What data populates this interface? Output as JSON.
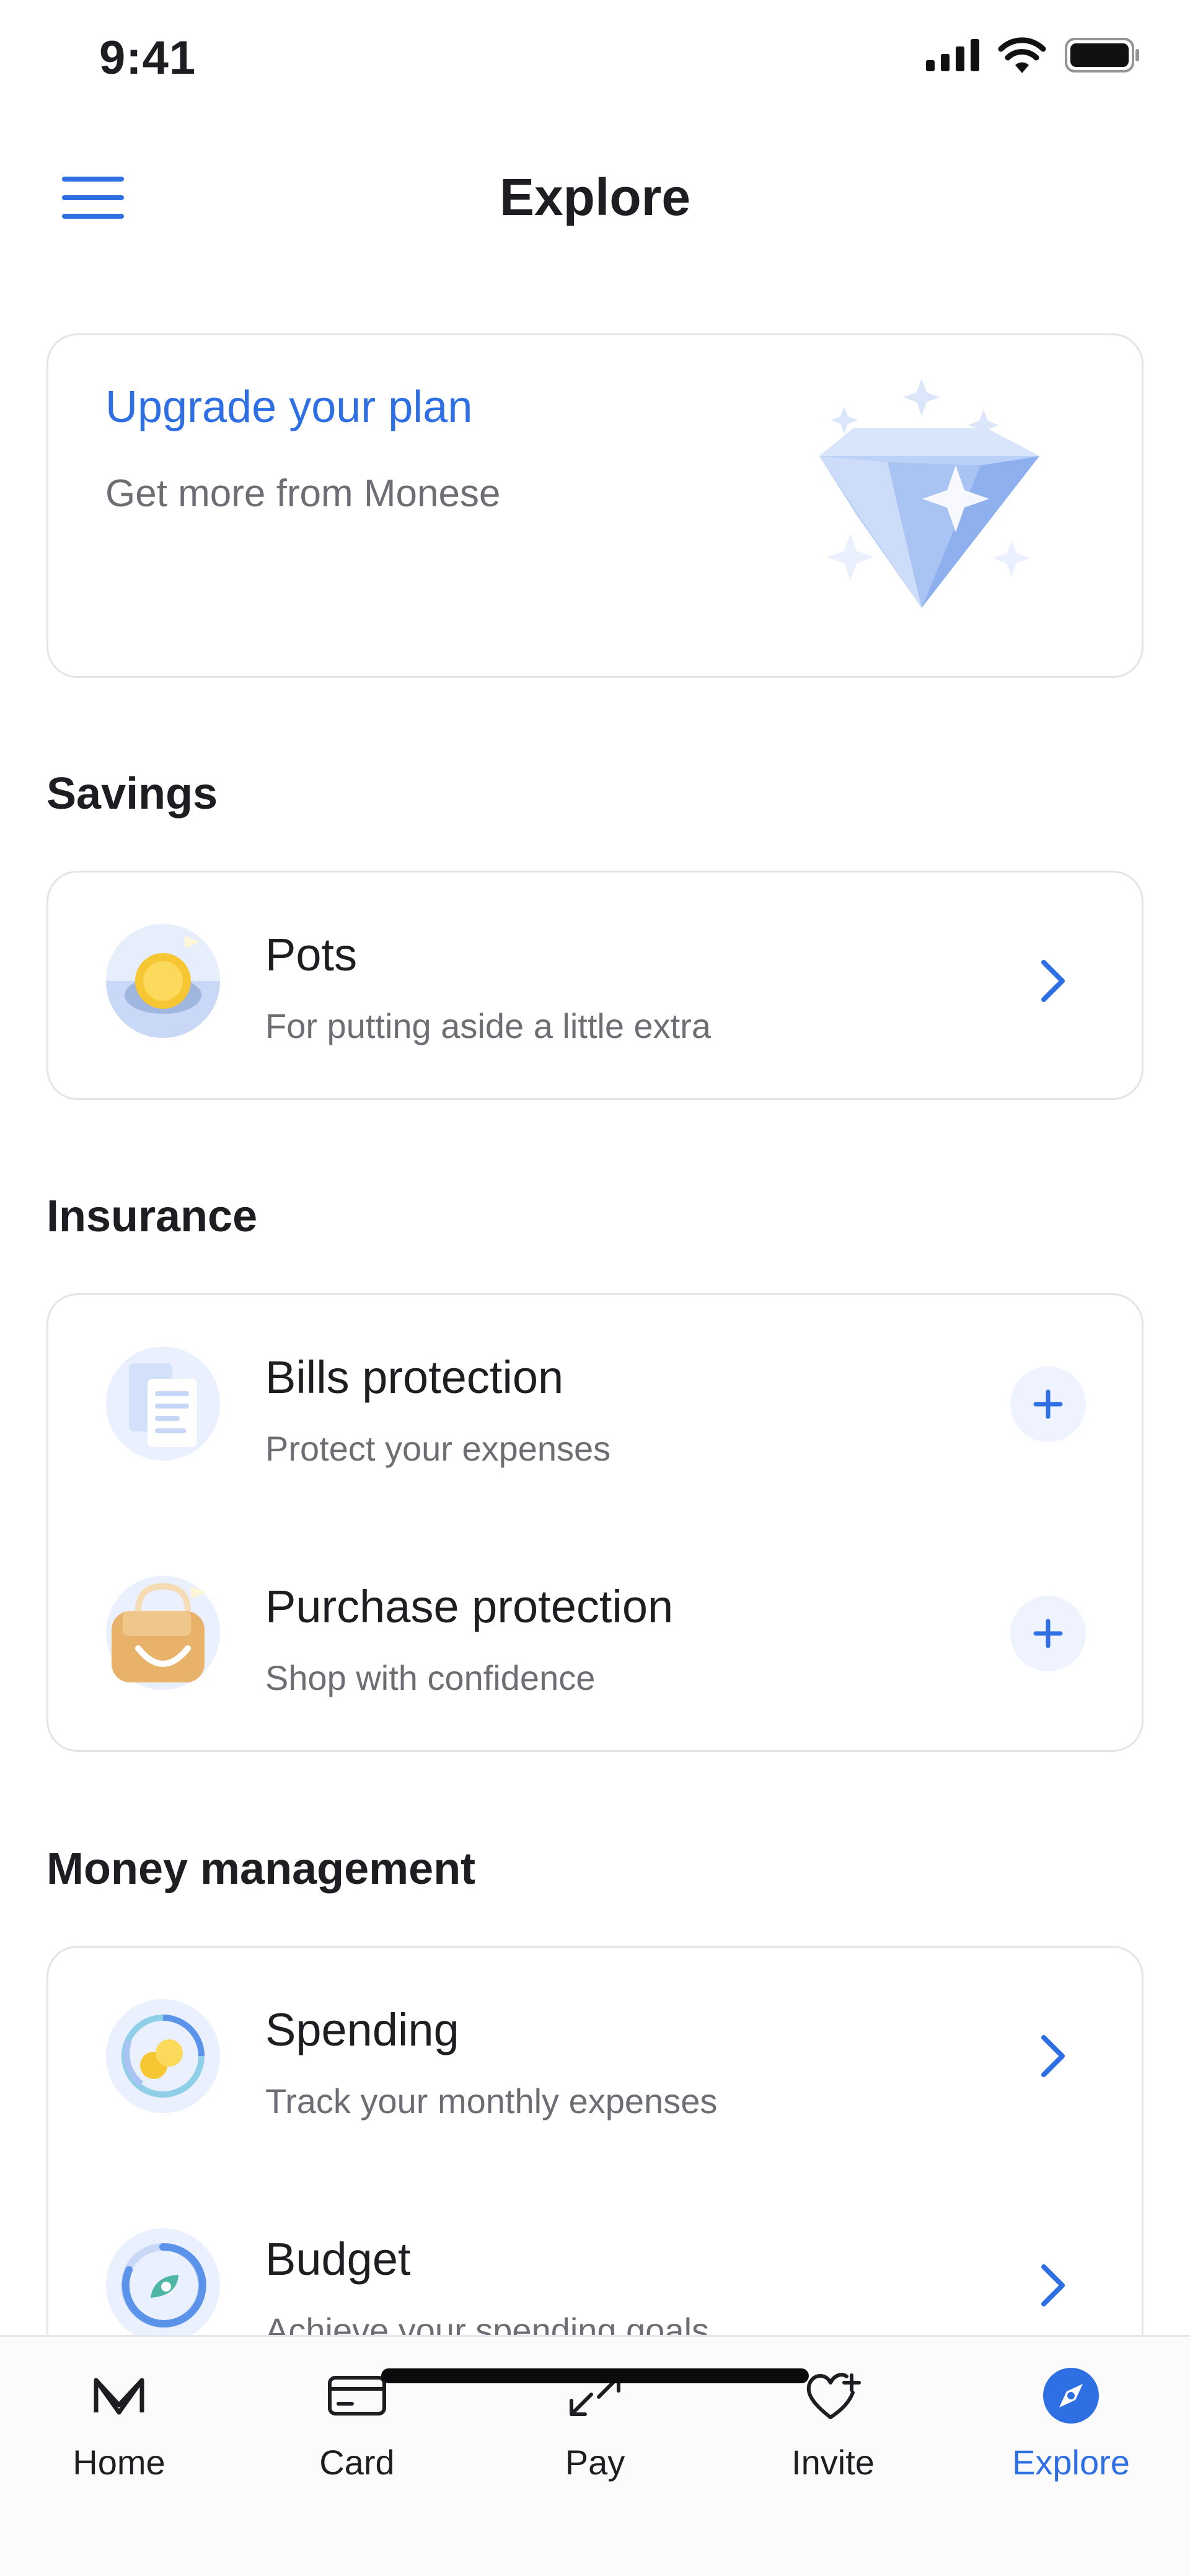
{
  "status_bar": {
    "time": "9:41"
  },
  "header": {
    "title": "Explore"
  },
  "upgrade": {
    "title": "Upgrade your plan",
    "subtitle": "Get more from Monese"
  },
  "sections": {
    "savings": {
      "title": "Savings",
      "items": [
        {
          "title": "Pots",
          "subtitle": "For putting aside a little extra",
          "action": "chevron-right-icon"
        }
      ]
    },
    "insurance": {
      "title": "Insurance",
      "items": [
        {
          "title": "Bills protection",
          "subtitle": "Protect your expenses",
          "action": "plus-icon"
        },
        {
          "title": "Purchase protection",
          "subtitle": "Shop with confidence",
          "action": "plus-icon"
        }
      ]
    },
    "money_management": {
      "title": "Money management",
      "items": [
        {
          "title": "Spending",
          "subtitle": "Track your monthly expenses",
          "action": "chevron-right-icon"
        },
        {
          "title": "Budget",
          "subtitle": "Achieve your spending goals",
          "action": "chevron-right-icon"
        }
      ]
    }
  },
  "bottom_nav": {
    "items": [
      {
        "label": "Home",
        "icon": "monese-logo-icon"
      },
      {
        "label": "Card",
        "icon": "card-icon"
      },
      {
        "label": "Pay",
        "icon": "transfer-arrows-icon"
      },
      {
        "label": "Invite",
        "icon": "heart-plus-icon"
      },
      {
        "label": "Explore",
        "icon": "compass-icon",
        "active": true
      }
    ]
  },
  "colors": {
    "accent": "#2f6fe4",
    "text": "#1d1d22",
    "muted": "#6d6d74",
    "border": "#e3e4ea"
  }
}
